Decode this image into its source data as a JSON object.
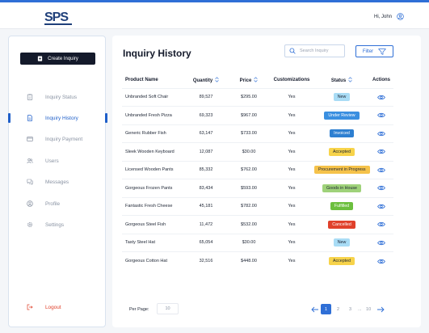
{
  "brand": {
    "logo_text": "SPS",
    "color": "#1f3f7a",
    "accent": "#2f6fd6"
  },
  "user": {
    "greeting": "Hi, John",
    "icon": "user-circle-icon"
  },
  "sidebar": {
    "create_label": "Create Inquiry",
    "items": [
      {
        "label": "Inquiry Status",
        "icon": "clipboard-icon"
      },
      {
        "label": "Inquiry History",
        "icon": "document-icon",
        "active": true
      },
      {
        "label": "Inquiry Payment",
        "icon": "credit-card-icon"
      },
      {
        "label": "Users",
        "icon": "users-icon"
      },
      {
        "label": "Messages",
        "icon": "chat-icon"
      },
      {
        "label": "Profile",
        "icon": "user-circle-icon"
      },
      {
        "label": "Settings",
        "icon": "gear-icon"
      }
    ],
    "logout_label": "Logout"
  },
  "main": {
    "title": "Inquiry History",
    "search_placeholder": "Search Inquiry",
    "filter_label": "Filter"
  },
  "table": {
    "columns": [
      "Product Name",
      "Quantity",
      "Price",
      "Customizations",
      "Status",
      "Actions"
    ],
    "rows": [
      {
        "product": "Unbranded Soft Chair",
        "quantity": "89,527",
        "price": "$295.00",
        "customizations": "Yes",
        "status": "New"
      },
      {
        "product": "Unbranded Fresh Pizza",
        "quantity": "69,323",
        "price": "$967.00",
        "customizations": "Yes",
        "status": "Under Review"
      },
      {
        "product": "Generic Rubber Fish",
        "quantity": "63,147",
        "price": "$733.00",
        "customizations": "Yes",
        "status": "Invoiced"
      },
      {
        "product": "Sleek Wooden Keyboard",
        "quantity": "12,087",
        "price": "$30.00",
        "customizations": "Yes",
        "status": "Accepted"
      },
      {
        "product": "Licensed Wooden Pants",
        "quantity": "85,332",
        "price": "$762.00",
        "customizations": "Yes",
        "status": "Procurement in Progress"
      },
      {
        "product": "Gorgeous Frozen Pants",
        "quantity": "83,434",
        "price": "$593.00",
        "customizations": "Yes",
        "status": "Goods in House"
      },
      {
        "product": "Fantastic Fresh Cheese",
        "quantity": "45,181",
        "price": "$782.00",
        "customizations": "Yes",
        "status": "Fulfilled"
      },
      {
        "product": "Gorgeous Steel Fish",
        "quantity": "11,472",
        "price": "$532.00",
        "customizations": "Yes",
        "status": "Cancelled"
      },
      {
        "product": "Tasty Steel Hat",
        "quantity": "65,054",
        "price": "$30.00",
        "customizations": "Yes",
        "status": "New"
      },
      {
        "product": "Gorgeous Cotton Hat",
        "quantity": "32,516",
        "price": "$448.00",
        "customizations": "Yes",
        "status": "Accepted"
      }
    ]
  },
  "status_colors": {
    "New": {
      "bg": "#a9dcf5",
      "fg": "#1c2433"
    },
    "Under Review": {
      "bg": "#3a8fe0",
      "fg": "#ffffff"
    },
    "Invoiced": {
      "bg": "#2d7fd1",
      "fg": "#ffffff"
    },
    "Accepted": {
      "bg": "#f7d34a",
      "fg": "#1c2433"
    },
    "Procurement in Progress": {
      "bg": "#f5c24a",
      "fg": "#1c2433"
    },
    "Goods in House": {
      "bg": "#9fd27a",
      "fg": "#1c2433"
    },
    "Fulfilled": {
      "bg": "#6cbf3e",
      "fg": "#ffffff"
    },
    "Cancelled": {
      "bg": "#e0412b",
      "fg": "#ffffff"
    }
  },
  "pagination": {
    "per_page_label": "Per Page:",
    "per_page_value": "10",
    "pages": [
      "1",
      "2",
      "3"
    ],
    "current": "1",
    "ellipsis": "...",
    "last": "10"
  }
}
